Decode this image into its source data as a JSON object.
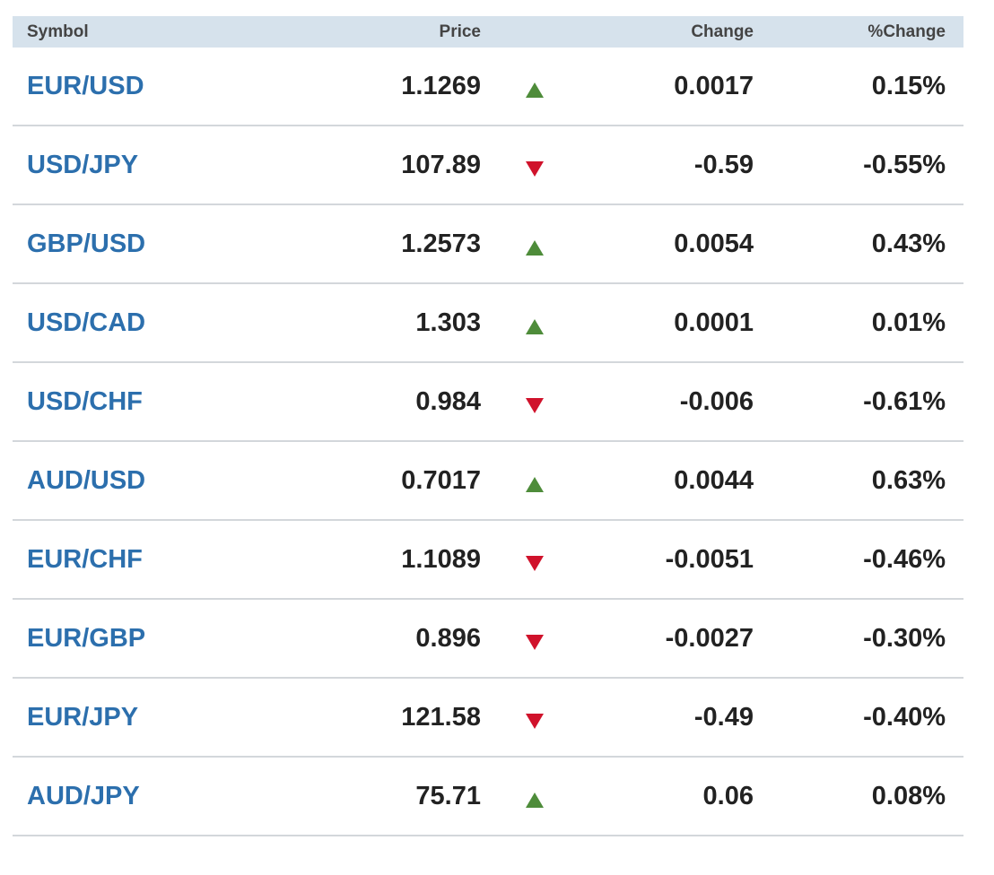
{
  "columns": {
    "symbol": "Symbol",
    "price": "Price",
    "change": "Change",
    "pct_change": "%Change"
  },
  "colors": {
    "up": "#4e8c3a",
    "down": "#d0122b",
    "link": "#2c6fad",
    "header_bg": "#d6e2ec"
  },
  "rows": [
    {
      "symbol": "EUR/USD",
      "price": "1.1269",
      "direction": "up",
      "change": "0.0017",
      "pct_change": "0.15%"
    },
    {
      "symbol": "USD/JPY",
      "price": "107.89",
      "direction": "down",
      "change": "-0.59",
      "pct_change": "-0.55%"
    },
    {
      "symbol": "GBP/USD",
      "price": "1.2573",
      "direction": "up",
      "change": "0.0054",
      "pct_change": "0.43%"
    },
    {
      "symbol": "USD/CAD",
      "price": "1.303",
      "direction": "up",
      "change": "0.0001",
      "pct_change": "0.01%"
    },
    {
      "symbol": "USD/CHF",
      "price": "0.984",
      "direction": "down",
      "change": "-0.006",
      "pct_change": "-0.61%"
    },
    {
      "symbol": "AUD/USD",
      "price": "0.7017",
      "direction": "up",
      "change": "0.0044",
      "pct_change": "0.63%"
    },
    {
      "symbol": "EUR/CHF",
      "price": "1.1089",
      "direction": "down",
      "change": "-0.0051",
      "pct_change": "-0.46%"
    },
    {
      "symbol": "EUR/GBP",
      "price": "0.896",
      "direction": "down",
      "change": "-0.0027",
      "pct_change": "-0.30%"
    },
    {
      "symbol": "EUR/JPY",
      "price": "121.58",
      "direction": "down",
      "change": "-0.49",
      "pct_change": "-0.40%"
    },
    {
      "symbol": "AUD/JPY",
      "price": "75.71",
      "direction": "up",
      "change": "0.06",
      "pct_change": "0.08%"
    }
  ]
}
